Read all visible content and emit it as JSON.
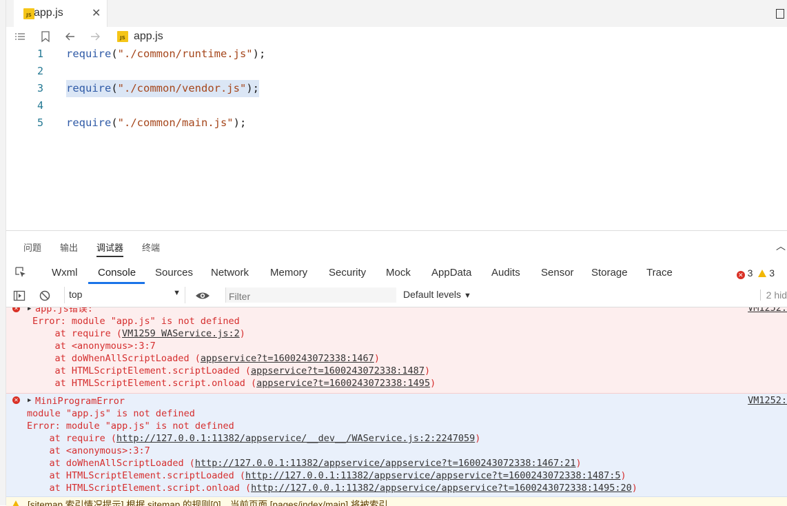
{
  "editor_tab": {
    "label": "app.js",
    "close": "✕",
    "badge": "JS"
  },
  "breadcrumb": {
    "file": "app.js"
  },
  "code_lines": [
    {
      "num": "1",
      "fn": "require",
      "open": "(",
      "str": "\"./common/runtime.js\"",
      "close": ");"
    },
    {
      "num": "2"
    },
    {
      "num": "3",
      "fn": "require",
      "open": "(",
      "str": "\"./common/vendor.js\"",
      "close": ");"
    },
    {
      "num": "4"
    },
    {
      "num": "5",
      "fn": "require",
      "open": "(",
      "str": "\"./common/main.js\"",
      "close": ");"
    }
  ],
  "devtools_top_tabs": [
    "问题",
    "输出",
    "调试器",
    "终端"
  ],
  "panel_tabs": [
    "Wxml",
    "Console",
    "Sources",
    "Network",
    "Memory",
    "Security",
    "Mock",
    "AppData",
    "Audits",
    "Sensor",
    "Storage",
    "Trace"
  ],
  "counts": {
    "errors": "3",
    "warnings": "3"
  },
  "toolbar": {
    "context": "top",
    "filter_placeholder": "Filter",
    "levels": "Default levels",
    "hidden": "2 hid"
  },
  "messages": {
    "err1": {
      "title": "app.js错误:",
      "source": "VM1252:",
      "lines": [
        {
          "pre": "Error: module \"app.js\" is not defined",
          "link": "",
          "post": ""
        },
        {
          "pre": "    at require (",
          "link": "VM1259 WAService.js:2",
          "post": ")"
        },
        {
          "pre": "    at <anonymous>:3:7",
          "link": "",
          "post": ""
        },
        {
          "pre": "    at doWhenAllScriptLoaded (",
          "link": "appservice?t=1600243072338:1467",
          "post": ")"
        },
        {
          "pre": "    at HTMLScriptElement.scriptLoaded (",
          "link": "appservice?t=1600243072338:1487",
          "post": ")"
        },
        {
          "pre": "    at HTMLScriptElement.script.onload (",
          "link": "appservice?t=1600243072338:1495",
          "post": ")"
        }
      ]
    },
    "err2": {
      "title": "MiniProgramError",
      "source": "VM1252:",
      "lines": [
        {
          "pre": "module \"app.js\" is not defined",
          "link": "",
          "post": ""
        },
        {
          "pre": "Error: module \"app.js\" is not defined",
          "link": "",
          "post": ""
        },
        {
          "pre": "    at require (",
          "link": "http://127.0.0.1:11382/appservice/__dev__/WAService.js:2:2247059",
          "post": ")"
        },
        {
          "pre": "    at <anonymous>:3:7",
          "link": "",
          "post": ""
        },
        {
          "pre": "    at doWhenAllScriptLoaded (",
          "link": "http://127.0.0.1:11382/appservice/appservice?t=1600243072338:1467:21",
          "post": ")"
        },
        {
          "pre": "    at HTMLScriptElement.scriptLoaded (",
          "link": "http://127.0.0.1:11382/appservice/appservice?t=1600243072338:1487:5",
          "post": ")"
        },
        {
          "pre": "    at HTMLScriptElement.script.onload (",
          "link": "http://127.0.0.1:11382/appservice/appservice?t=1600243072338:1495:20",
          "post": ")"
        }
      ]
    },
    "warn": {
      "text": "[sitemap 索引情况提示] 根据 sitemap 的规则[0]，当前页面 [pages/index/main] 将被索引"
    }
  }
}
